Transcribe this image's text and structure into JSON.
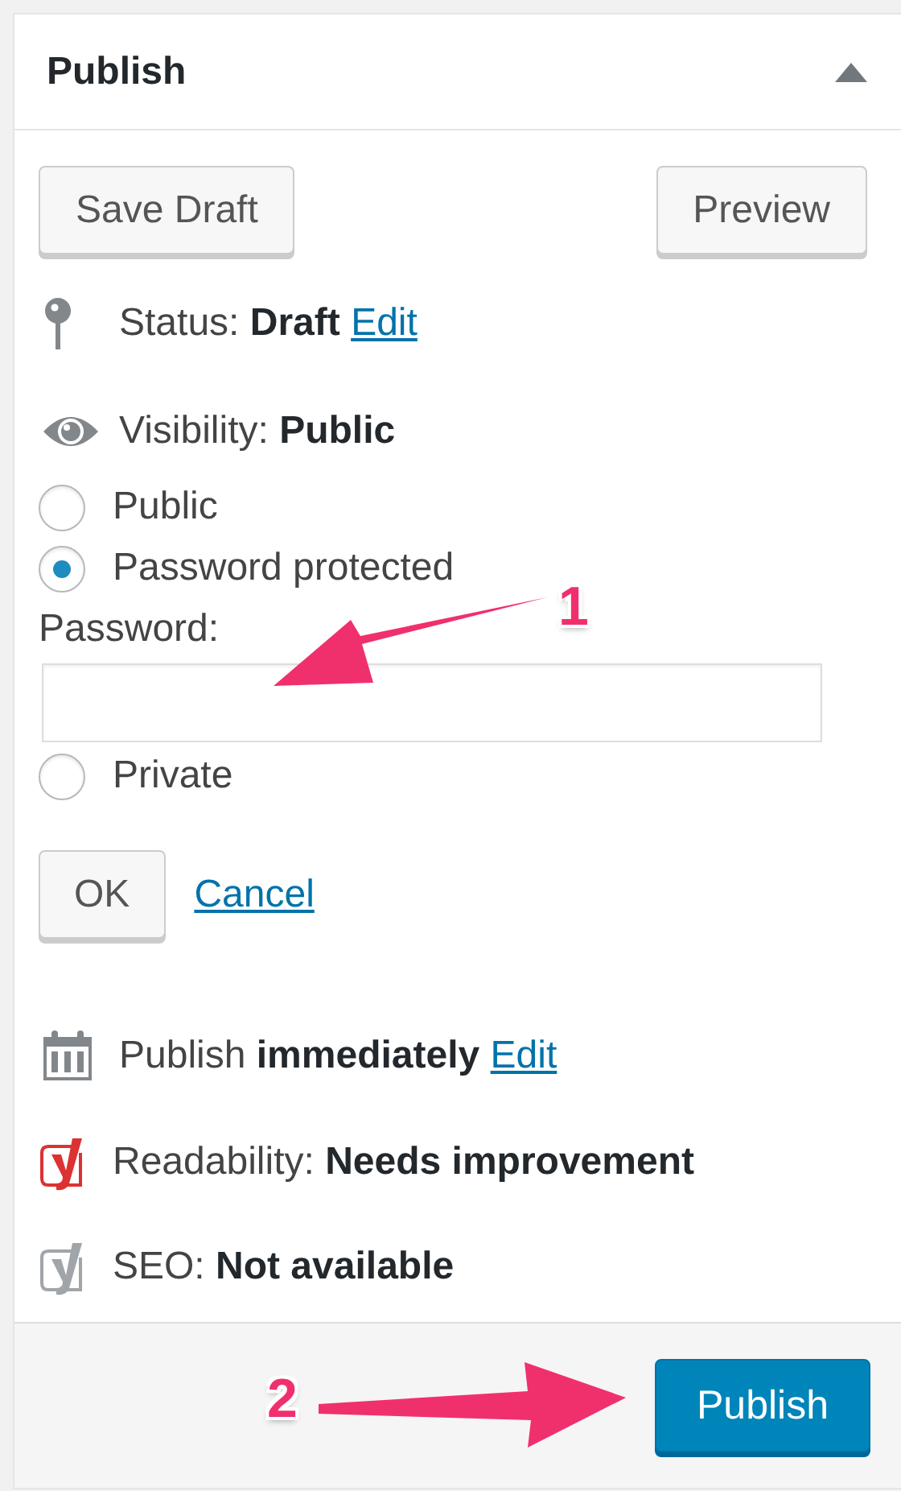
{
  "panel": {
    "title": "Publish",
    "expanded": true
  },
  "actions": [
    {
      "label": "Save Draft"
    },
    {
      "label": "Preview"
    }
  ],
  "status": {
    "text": "Status: **Draft**",
    "link": "Edit"
  },
  "visibility": {
    "text": "Visibility: **Public**",
    "options": [
      {
        "label": "Public",
        "selected": false
      },
      {
        "label": "Password protected",
        "selected": true,
        "field": {
          "label": "Password:"
        }
      },
      {
        "label": "Private",
        "selected": false
      }
    ],
    "ok": "OK",
    "cancel": "Cancel"
  },
  "schedule": {
    "text": "Publish **immediately**",
    "link": "Edit"
  },
  "checks": [
    {
      "text": "Readability: **Needs improvement**",
      "color": "#dc3232"
    },
    {
      "text": "SEO: **Not available**",
      "color": "#a0a5aa"
    }
  ],
  "publish_button": "Publish",
  "annotations": [
    {
      "number": "1"
    },
    {
      "number": "2"
    }
  ]
}
